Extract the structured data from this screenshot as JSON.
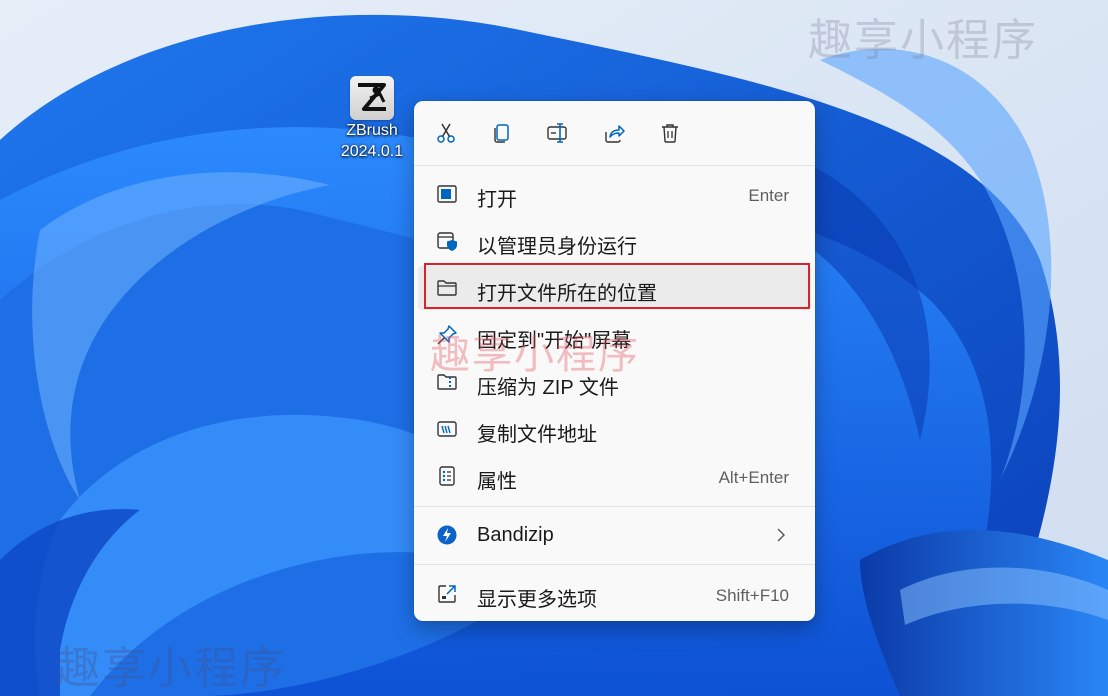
{
  "desktop": {
    "icons": [
      {
        "label_line1": "ZBrush",
        "label_line2": "2024.0.1",
        "icon": "zbrush-app-icon"
      }
    ]
  },
  "watermarks": [
    "趣享小程序",
    "趣享小程序",
    "趣享小程序"
  ],
  "context_menu": {
    "toolbar": [
      {
        "icon": "cut-icon"
      },
      {
        "icon": "copy-icon"
      },
      {
        "icon": "rename-icon"
      },
      {
        "icon": "share-icon"
      },
      {
        "icon": "delete-icon"
      }
    ],
    "items": [
      {
        "label": "打开",
        "shortcut": "Enter",
        "icon": "open-icon"
      },
      {
        "label": "以管理员身份运行",
        "shortcut": "",
        "icon": "run-as-admin-icon"
      },
      {
        "label": "打开文件所在的位置",
        "shortcut": "",
        "icon": "folder-icon",
        "highlighted": true
      },
      {
        "label": "固定到\"开始\"屏幕",
        "shortcut": "",
        "icon": "pin-icon"
      },
      {
        "label": "压缩为 ZIP 文件",
        "shortcut": "",
        "icon": "zip-folder-icon"
      },
      {
        "label": "复制文件地址",
        "shortcut": "",
        "icon": "copy-path-icon"
      },
      {
        "label": "属性",
        "shortcut": "Alt+Enter",
        "icon": "properties-icon"
      },
      {
        "label": "Bandizip",
        "shortcut": "",
        "icon": "bandizip-icon",
        "submenu": true
      },
      {
        "label": "显示更多选项",
        "shortcut": "Shift+F10",
        "icon": "more-options-icon"
      }
    ]
  },
  "colors": {
    "accent": "#0067c0",
    "highlight_border": "#d9222a"
  }
}
